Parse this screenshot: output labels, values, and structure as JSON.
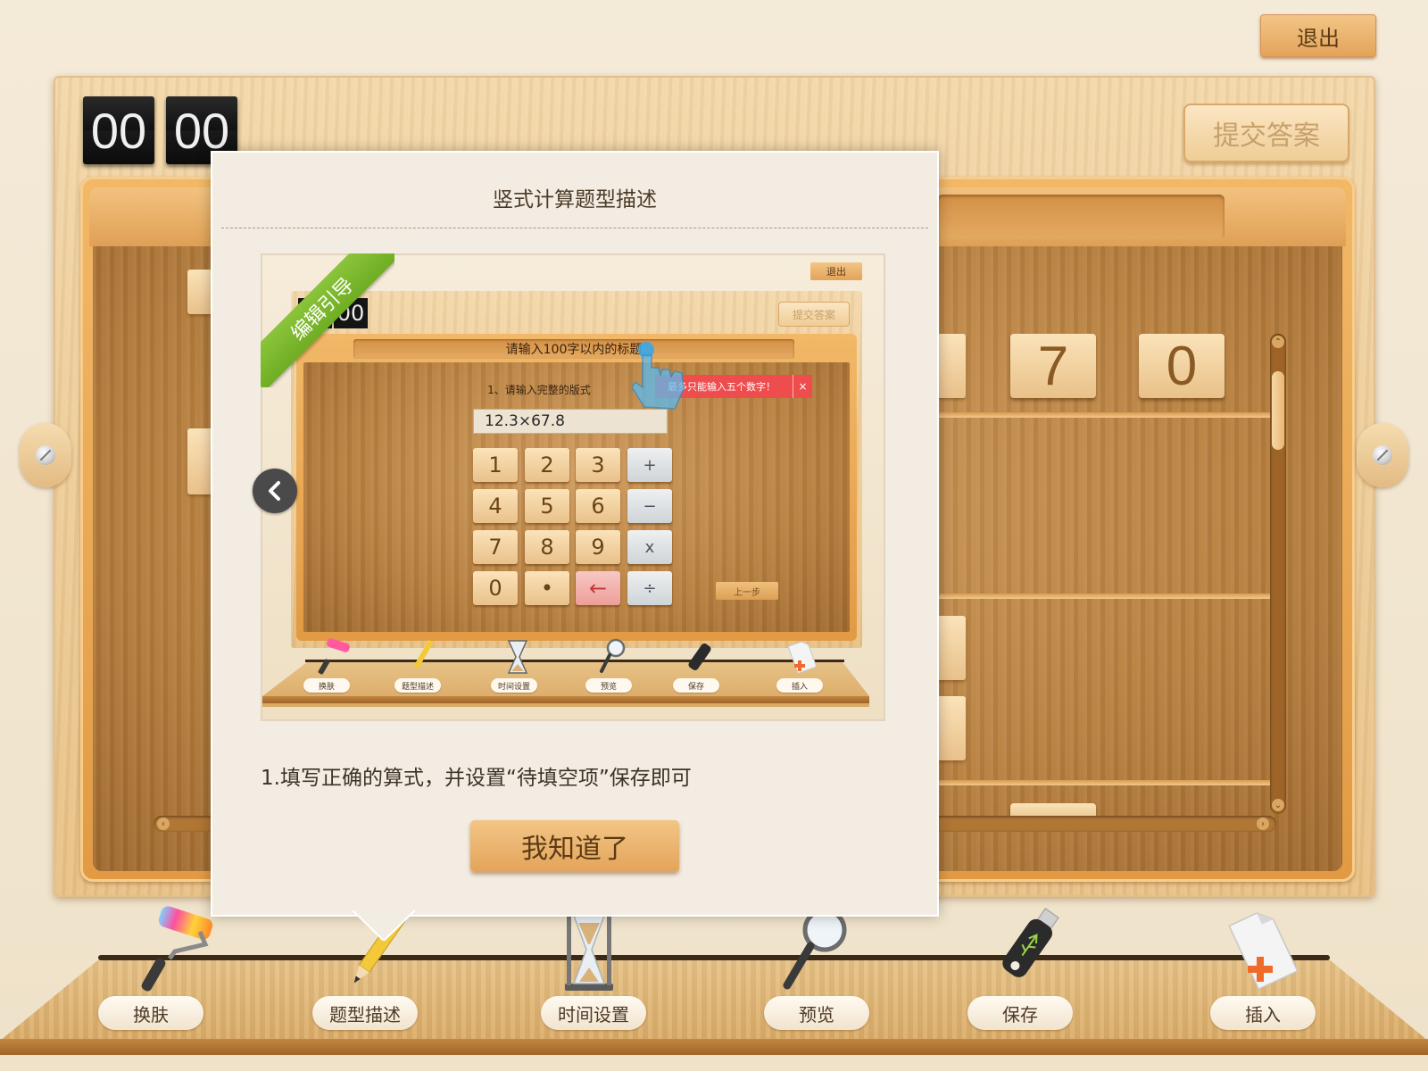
{
  "header": {
    "exit_label": "退出"
  },
  "board": {
    "timer": {
      "minutes": "00",
      "seconds": "00"
    },
    "submit_label": "提交答案",
    "digits": [
      "7",
      "0"
    ]
  },
  "modal": {
    "title": "竖式计算题型描述",
    "ribbon_label": "编辑引导",
    "description": "1.填写正确的算式，并设置“待填空项”保存即可",
    "ok_label": "我知道了",
    "preview": {
      "exit_label": "退出",
      "timer_seconds": "00",
      "submit_label": "提交答案",
      "title_placeholder": "请输入100字以内的标题",
      "instruction": "1、请输入完整的版式",
      "formula": "12.3×67.8",
      "toast": "最多只能输入五个数字！",
      "toast_close": "×",
      "keys": [
        "1",
        "2",
        "3",
        "+",
        "4",
        "5",
        "6",
        "−",
        "7",
        "8",
        "9",
        "x",
        "0",
        "•",
        "←",
        "÷"
      ],
      "prev_step": "上一步",
      "tools": [
        "换肤",
        "题型描述",
        "时间设置",
        "预览",
        "保存",
        "插入"
      ]
    }
  },
  "toolbar": {
    "items": [
      {
        "label": "换肤",
        "icon": "paint-roller-icon"
      },
      {
        "label": "题型描述",
        "icon": "pencil-icon"
      },
      {
        "label": "时间设置",
        "icon": "hourglass-icon"
      },
      {
        "label": "预览",
        "icon": "magnifier-icon"
      },
      {
        "label": "保存",
        "icon": "usb-drive-icon"
      },
      {
        "label": "插入",
        "icon": "insert-document-icon"
      }
    ]
  },
  "colors": {
    "ribbon": "#7dbb2e",
    "toast": "#ef4d4d",
    "button_orange": "#e8ac62"
  }
}
